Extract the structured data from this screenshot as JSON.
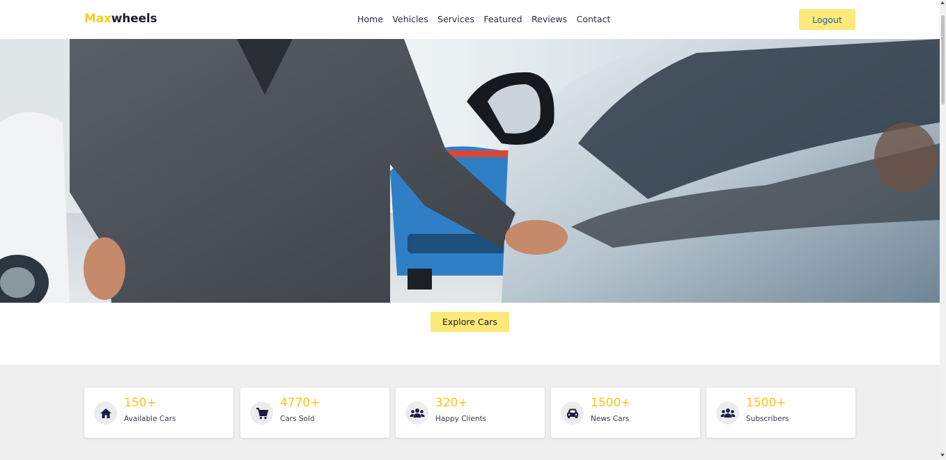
{
  "header": {
    "logo_accent": "Max",
    "logo_rest": "wheels",
    "nav": [
      "Home",
      "Vehicles",
      "Services",
      "Featured",
      "Reviews",
      "Contact"
    ],
    "logout_label": "Logout"
  },
  "hero": {
    "explore_label": "Explore Cars"
  },
  "stats": [
    {
      "value": "150+",
      "label": "Available Cars",
      "icon": "home-icon"
    },
    {
      "value": "4770+",
      "label": "Cars Sold",
      "icon": "cart-icon"
    },
    {
      "value": "320+",
      "label": "Happy Clients",
      "icon": "users-icon"
    },
    {
      "value": "1500+",
      "label": "News Cars",
      "icon": "car-icon"
    },
    {
      "value": "1500+",
      "label": "Subscribers",
      "icon": "users-icon"
    }
  ],
  "colors": {
    "accent": "#f5c518",
    "button": "#fde97a",
    "stats_band": "#efefef",
    "icon_dark": "#1b1b4b"
  }
}
